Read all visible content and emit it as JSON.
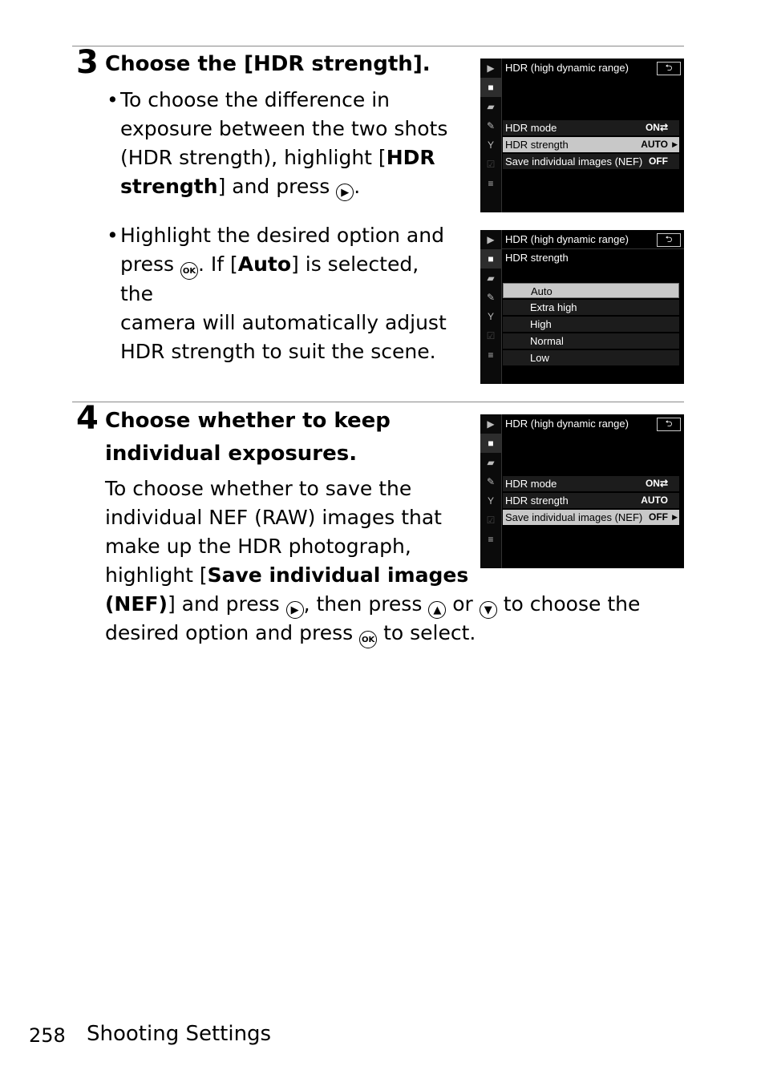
{
  "step3": {
    "number": "3",
    "heading": "Choose the [HDR strength].",
    "bullet1": {
      "l1": "To choose the difference in",
      "l2": "exposure between the two shots",
      "l3a": "(HDR strength), highlight [",
      "l3b": "HDR",
      "l4a": "strength",
      "l4b": "] and press",
      "l4c": "."
    },
    "bullet2": {
      "l1": "Highlight the desired option and",
      "l2a": "press",
      "l2b": ". If [",
      "l2c": "Auto",
      "l2d": "] is selected, the",
      "l3": "camera will automatically adjust",
      "l4": "HDR strength to suit the scene."
    }
  },
  "step4": {
    "number": "4",
    "heading_l1": "Choose whether to keep",
    "heading_l2": "individual exposures.",
    "l1": "To choose whether to save the",
    "l2": "individual NEF (RAW) images that",
    "l3": "make up the HDR photograph,",
    "l4a": "highlight [",
    "l4b": "Save individual images",
    "l5a": "(NEF)",
    "l5b": "] and press",
    "l5c": ", then press",
    "l5d": "or",
    "l5e": "to choose the",
    "l6a": "desired option and press",
    "l6b": "to select."
  },
  "glyphs": {
    "right": "▶",
    "up": "▲",
    "down": "▼",
    "ok": "OK"
  },
  "camera_screens": {
    "title": "HDR (high dynamic range)",
    "back": "⮌",
    "sidebar": [
      "▶",
      "■",
      "▰",
      "✎",
      "Y",
      "☑",
      "≡"
    ],
    "menu": {
      "rows": [
        {
          "label": "HDR mode",
          "value": "ON⇄"
        },
        {
          "label": "HDR strength",
          "value": "AUTO"
        },
        {
          "label": "Save individual images (NEF)",
          "value": "OFF"
        }
      ]
    },
    "strength": {
      "subtitle": "HDR strength",
      "options": [
        "Auto",
        "Extra high",
        "High",
        "Normal",
        "Low"
      ]
    },
    "arrow": "▶"
  },
  "footer": {
    "page_number": "258",
    "section": "Shooting Settings"
  }
}
